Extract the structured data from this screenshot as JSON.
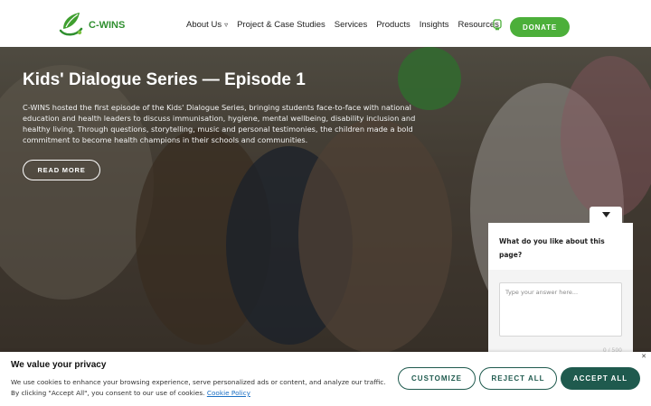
{
  "brand": {
    "name": "C-WINS",
    "accent": "#4caf3a",
    "dark_green": "#1f5a4e"
  },
  "nav": {
    "items": [
      {
        "label": "About Us",
        "has_dropdown": true
      },
      {
        "label": "Project & Case Studies"
      },
      {
        "label": "Services"
      },
      {
        "label": "Products"
      },
      {
        "label": "Insights"
      },
      {
        "label": "Resources"
      }
    ],
    "donate_label": "DONATE"
  },
  "hero": {
    "title": "Kids' Dialogue Series — Episode 1",
    "description": "C-WINS hosted the first episode of the Kids' Dialogue Series, bringing students face-to-face with national education and health leaders to discuss immunisation, hygiene, mental wellbeing, disability inclusion and healthy living. Through questions, storytelling, music and personal testimonies, the children made a bold commitment to become health champions in their schools and communities.",
    "cta_label": "READ MORE"
  },
  "feedback": {
    "question": "What do you like about this page?",
    "placeholder": "Type your answer here...",
    "counter": "0 / 500"
  },
  "cookie": {
    "title": "We value your privacy",
    "text": "We use cookies to enhance your browsing experience, serve personalized ads or content, and analyze our traffic. By clicking \"Accept All\", you consent to our use of cookies.",
    "policy_link": "Cookie Policy",
    "customize_label": "CUSTOMIZE",
    "reject_label": "REJECT ALL",
    "accept_label": "ACCEPT ALL"
  }
}
